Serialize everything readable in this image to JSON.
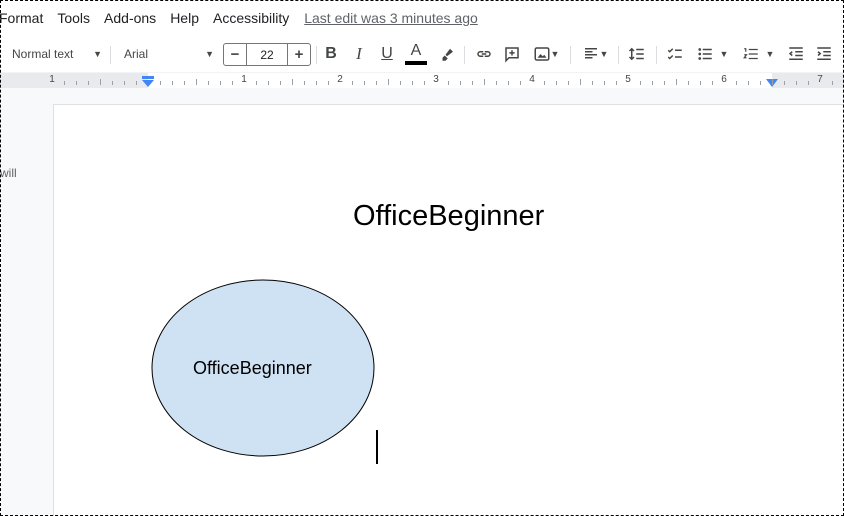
{
  "menubar": {
    "items": [
      "Format",
      "Tools",
      "Add-ons",
      "Help",
      "Accessibility"
    ],
    "last_edit": "Last edit was 3 minutes ago"
  },
  "toolbar": {
    "style": "Normal text",
    "font": "Arial",
    "font_size": "22",
    "minus": "−",
    "plus": "+",
    "bold": "B",
    "italic": "I",
    "underline": "U",
    "text_color_letter": "A",
    "text_color": "#000000"
  },
  "ruler": {
    "numbers": [
      "1",
      "1",
      "2",
      "3",
      "4",
      "5",
      "6",
      "7"
    ],
    "marker_color": "#4285f4"
  },
  "side_note": "will",
  "document": {
    "title": "OfficeBeginner",
    "shape": {
      "label": "OfficeBeginner",
      "fill": "#cfe2f3",
      "stroke": "#000000"
    }
  }
}
